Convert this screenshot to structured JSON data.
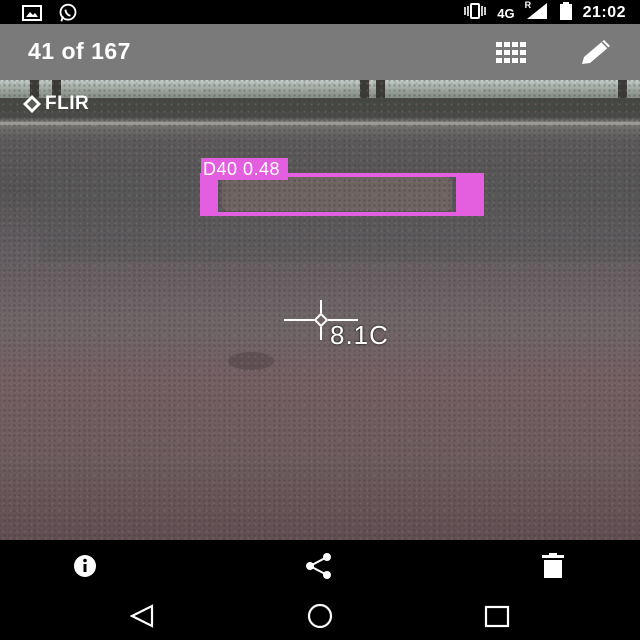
{
  "status_bar": {
    "left_icons": [
      "image-icon",
      "whatsapp-icon"
    ],
    "right_icons": [
      "vibrate-icon",
      "signal-icon",
      "battery-icon"
    ],
    "network": "4G",
    "roaming": "R",
    "time": "21:02"
  },
  "toolbar": {
    "counter": "41 of 167",
    "grid_icon": "grid-icon",
    "edit_icon": "pencil-icon"
  },
  "photo": {
    "brand": "FLIR",
    "detection_label": "D40  0.48",
    "temperature": "8.1C",
    "detection_color": "#e45ee0"
  },
  "action_bar": {
    "icons": [
      "info-icon",
      "share-icon",
      "delete-icon"
    ]
  },
  "nav_bar": {
    "icons": [
      "back-icon",
      "home-icon",
      "recents-icon"
    ]
  }
}
